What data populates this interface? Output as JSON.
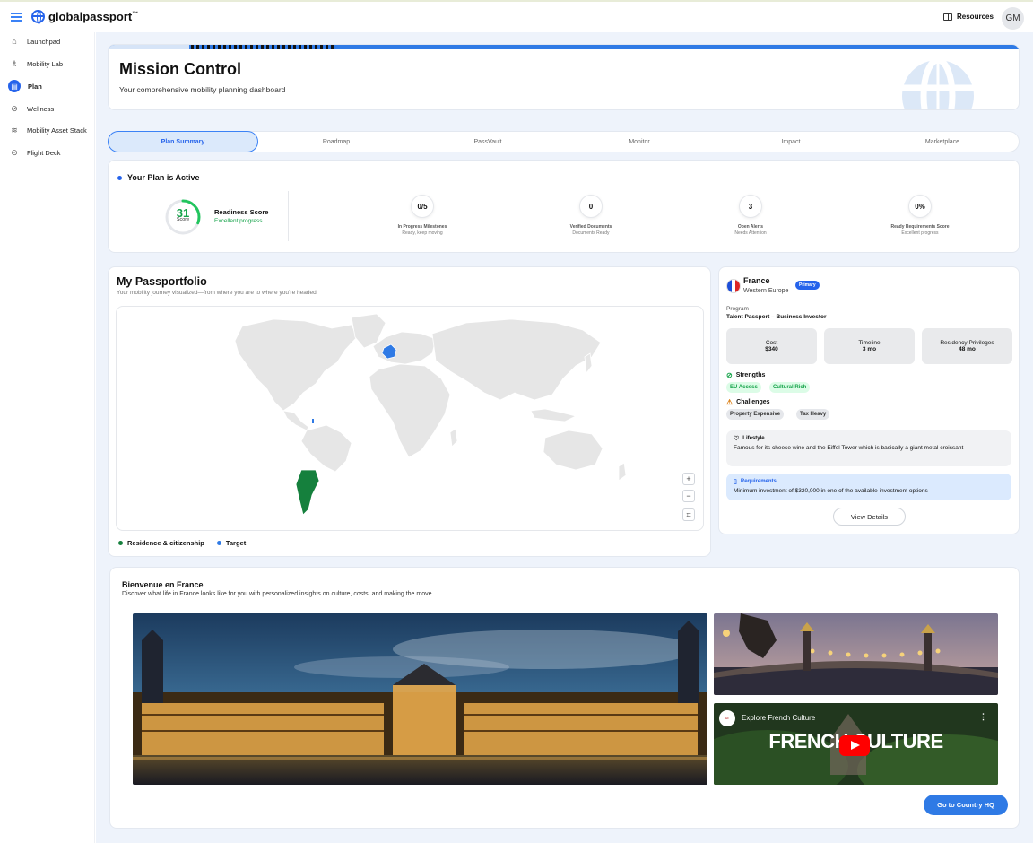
{
  "app": {
    "logo_text": "globalpassport",
    "logo_mark": "™",
    "resources_label": "Resources",
    "avatar_initials": "GM"
  },
  "sidebar": {
    "items": [
      {
        "label": "Launchpad",
        "icon": "home-icon",
        "active": false
      },
      {
        "label": "Mobility Lab",
        "icon": "flask-icon",
        "active": false
      },
      {
        "label": "Plan",
        "icon": "clipboard-icon",
        "active": true
      },
      {
        "label": "Wellness",
        "icon": "compass-icon",
        "active": false
      },
      {
        "label": "Mobility Asset Stack",
        "icon": "layers-icon",
        "active": false
      },
      {
        "label": "Flight Deck",
        "icon": "target-icon",
        "active": false
      }
    ]
  },
  "header": {
    "title": "Mission Control",
    "subtitle": "Your comprehensive mobility planning dashboard"
  },
  "tabs": [
    {
      "label": "Plan Summary",
      "active": true
    },
    {
      "label": "Roadmap",
      "active": false
    },
    {
      "label": "PassVault",
      "active": false
    },
    {
      "label": "Monitor",
      "active": false
    },
    {
      "label": "Impact",
      "active": false
    },
    {
      "label": "Marketplace",
      "active": false
    }
  ],
  "plan": {
    "title": "Your Plan is Active",
    "score": {
      "value": "31",
      "unit_label": "Score",
      "progress": 0.31,
      "title": "Readiness Score",
      "status": "Excellent progress"
    },
    "stats": [
      {
        "value": "0/5",
        "label": "In Progress Milestones",
        "sub": "Ready, keep moving"
      },
      {
        "value": "0",
        "label": "Verified Documents",
        "sub": "Documents Ready"
      },
      {
        "value": "3",
        "label": "Open Alerts",
        "sub": "Needs Attention"
      },
      {
        "value": "0%",
        "label": "Ready Requirements Score",
        "sub": "Excellent progress"
      }
    ]
  },
  "passportfolio": {
    "title": "My Passportfolio",
    "subtitle": "Your mobility journey visualized—from where you are to where you’re headed.",
    "zoom_in": "+",
    "zoom_out": "−",
    "reset": "⌗",
    "legend": [
      {
        "label": "Residence & citizenship",
        "color": "#15803d"
      },
      {
        "label": "Target",
        "color": "#2f7ae5"
      }
    ]
  },
  "country": {
    "name": "France",
    "region": "Western Europe",
    "badge": "Primary",
    "program_label": "Program",
    "program_value": "Talent Passport – Business Investor",
    "metrics": [
      {
        "label": "Cost",
        "value": "$340"
      },
      {
        "label": "Timeline",
        "value": "3 mo"
      },
      {
        "label": "Residency Privileges",
        "value": "48 mo"
      }
    ],
    "strengths_label": "Strengths",
    "strengths": [
      "EU Access",
      "Cultural Rich"
    ],
    "challenges_label": "Challenges",
    "challenges": [
      "Property Expensive",
      "Tax Heavy"
    ],
    "lifestyle_label": "Lifestyle",
    "lifestyle_text": "Famous for its cheese wine and the Eiffel Tower which is basically a giant metal croissant",
    "requirements_label": "Requirements",
    "requirements_text": "Minimum investment of $320,000 in one of the available investment options",
    "view_details": "View Details"
  },
  "welcome": {
    "title": "Bienvenue en France",
    "subtitle": "Discover what life in France looks like for you with personalized insights on culture, costs, and making the move.",
    "video_title": "Explore French Culture",
    "video_overlay": "FRENCH CULTURE",
    "video_menu": "⋮",
    "cta": "Go to Country HQ"
  },
  "colors": {
    "accent": "#2f7ae5",
    "success": "#16a34a",
    "background": "#eef3fb"
  }
}
